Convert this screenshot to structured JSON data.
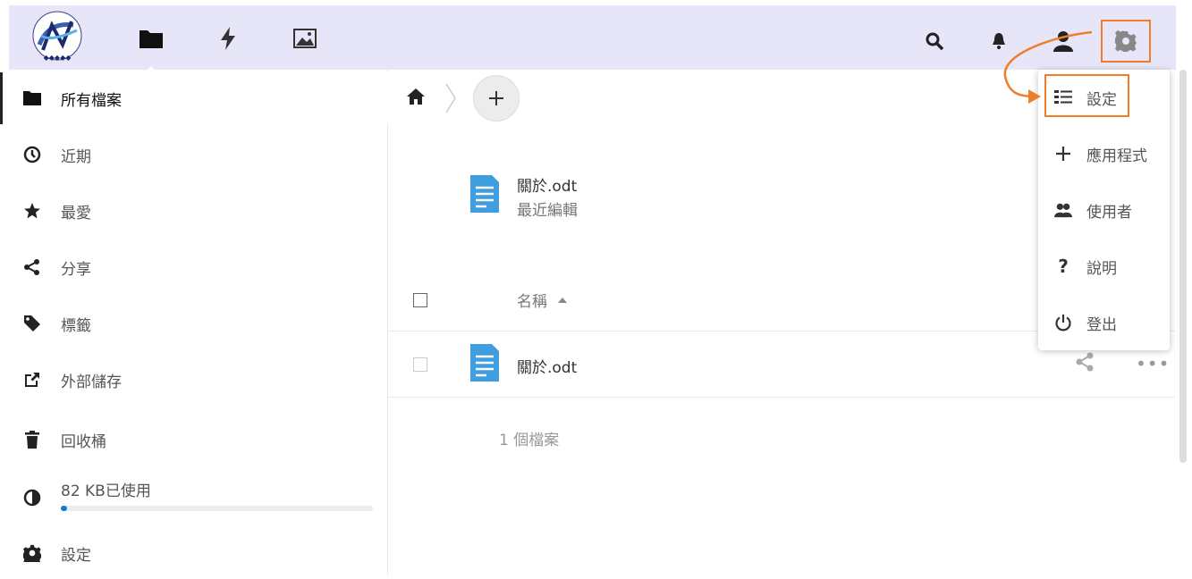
{
  "header": {
    "apps": [
      "folder-icon",
      "activity-icon",
      "image-icon"
    ],
    "right_icons": [
      "search-icon",
      "bell-icon",
      "contacts-icon",
      "gear-icon"
    ],
    "accent_color": "#f07d2a",
    "bar_color": "#e6e6f8"
  },
  "sidebar": {
    "items": [
      {
        "label": "所有檔案",
        "icon": "folder-icon"
      },
      {
        "label": "近期",
        "icon": "clock-icon"
      },
      {
        "label": "最愛",
        "icon": "star-icon"
      },
      {
        "label": "分享",
        "icon": "share-icon"
      },
      {
        "label": "標籤",
        "icon": "tag-icon"
      },
      {
        "label": "外部儲存",
        "icon": "external-icon"
      },
      {
        "label": "回收桶",
        "icon": "trash-icon"
      }
    ],
    "quota": {
      "label": "82 KB已使用",
      "fraction": 0.005
    },
    "settings_label": "設定"
  },
  "main": {
    "recent": {
      "name": "關於.odt",
      "sub": "最近編輯"
    },
    "column_name": "名稱",
    "files": [
      {
        "name": "關於.odt"
      }
    ],
    "summary": "1 個檔案"
  },
  "menu": {
    "items": [
      {
        "label": "設定",
        "icon": "list-icon"
      },
      {
        "label": "應用程式",
        "icon": "plus-icon"
      },
      {
        "label": "使用者",
        "icon": "users-icon"
      },
      {
        "label": "說明",
        "icon": "help-icon"
      },
      {
        "label": "登出",
        "icon": "power-icon"
      }
    ]
  }
}
